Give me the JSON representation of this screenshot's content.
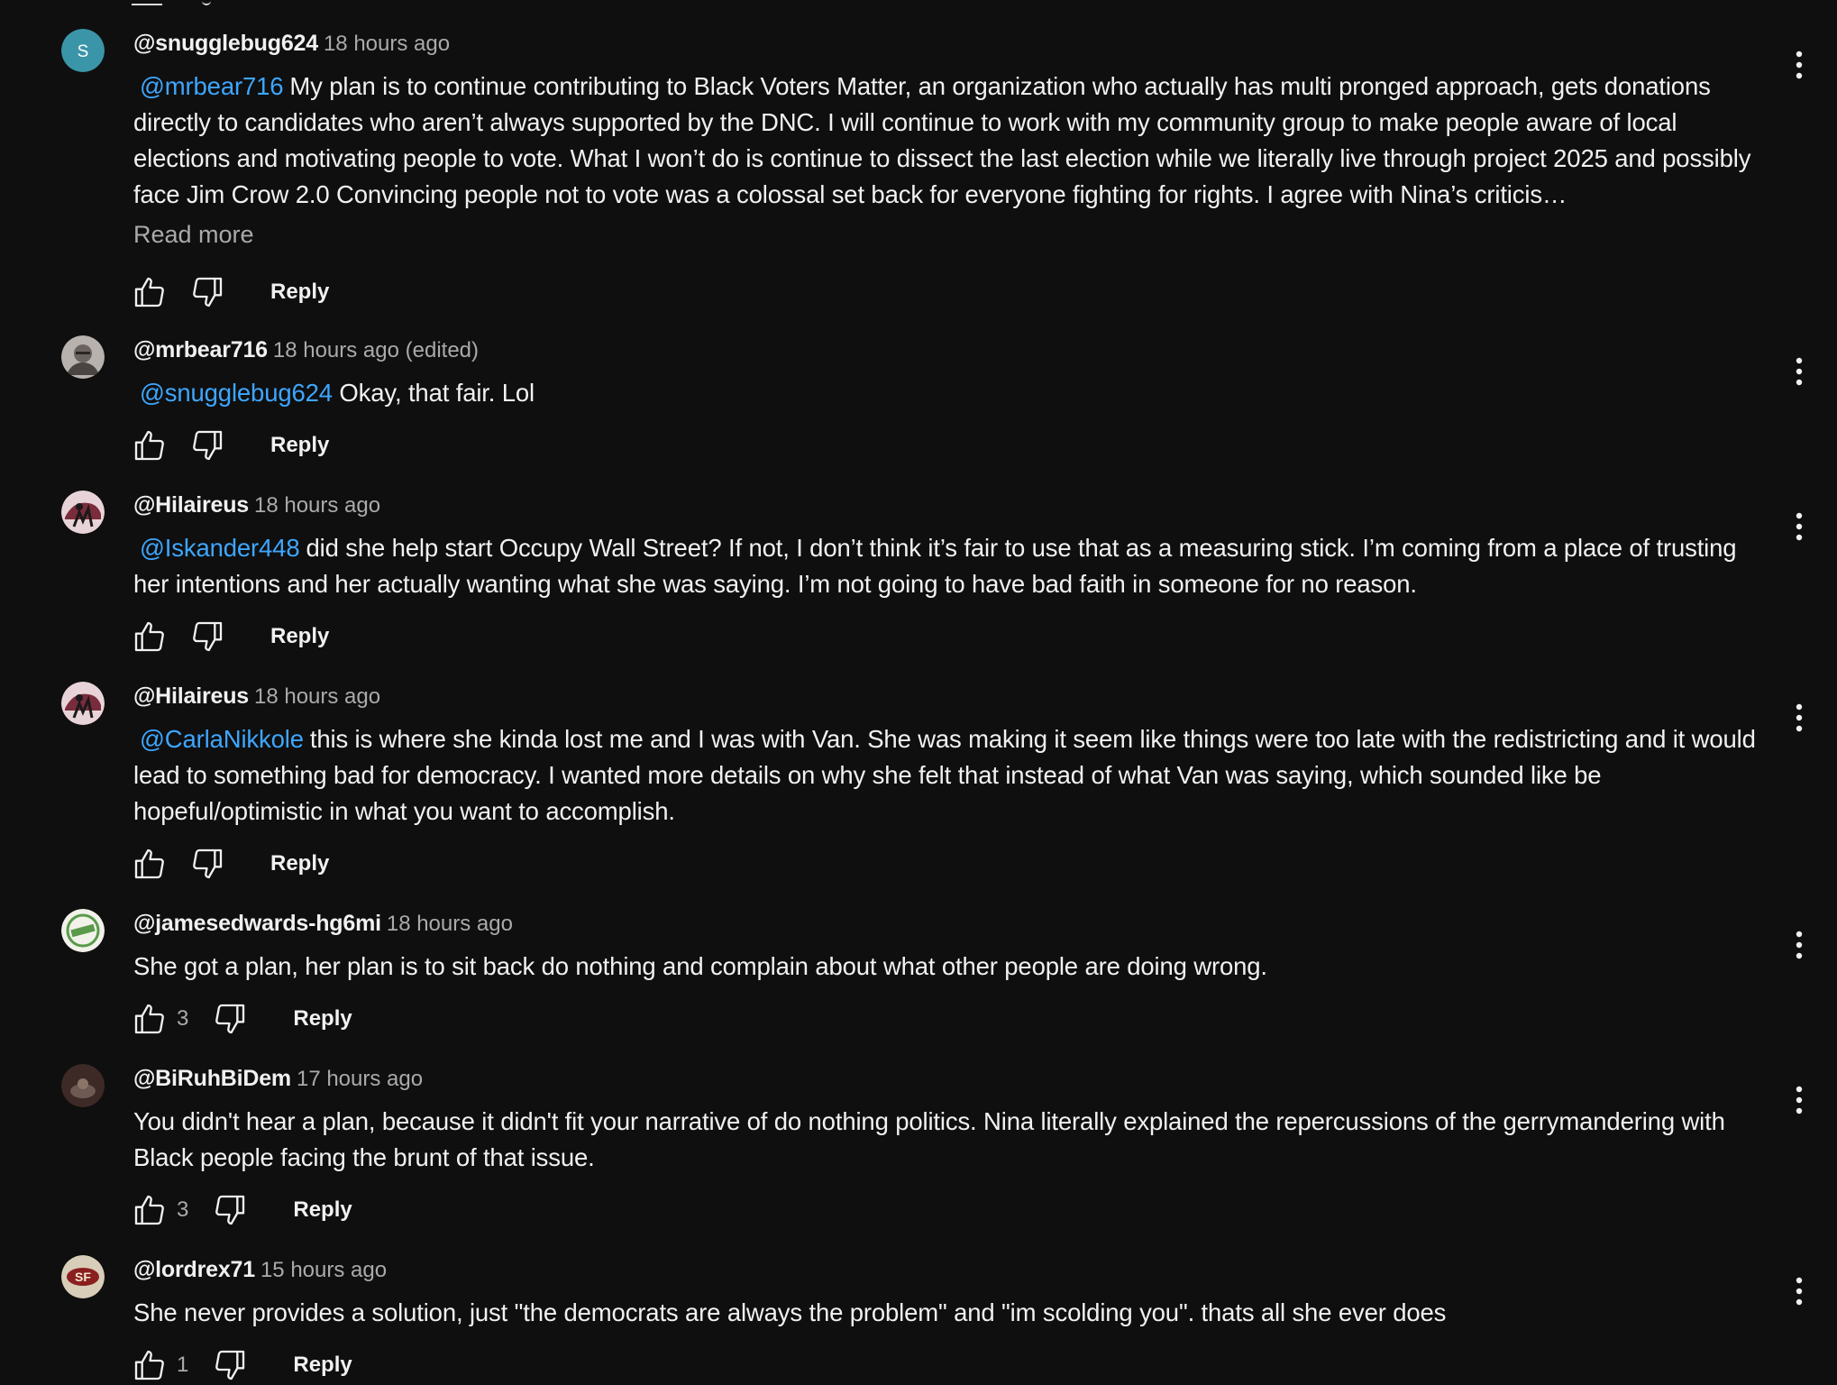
{
  "comments": [
    {
      "author": "@snugglebug624",
      "time": "18 hours ago",
      "mention": "@mrbear716",
      "text": "My plan is to continue contributing to Black Voters Matter, an organization who actually has multi pronged approach, gets donations directly to candidates who aren’t always supported by the DNC. I will continue to work with my community group to make people aware of local elections and motivating people to vote. What I won’t do is continue to dissect the last election while we literally live through project 2025 and possibly face Jim Crow 2.0 Convincing people not to vote was a colossal set back for everyone fighting for rights. I agree with Nina’s criticis…",
      "read_more": "Read more",
      "likes": "",
      "reply": "Reply",
      "avatar": {
        "type": "letter",
        "letter": "S",
        "color": "#3b95a9"
      }
    },
    {
      "author": "@mrbear716",
      "time": "18 hours ago (edited)",
      "mention": "@snugglebug624",
      "text": "Okay, that fair. Lol",
      "likes": "",
      "reply": "Reply",
      "avatar": {
        "type": "photo",
        "color": "#6b6360"
      }
    },
    {
      "author": "@Hilaireus",
      "time": "18 hours ago",
      "mention": "@Iskander448",
      "text": "did she help start Occupy Wall Street? If not, I don’t think it’s fair to use that as a measuring stick. I’m coming from a place of trusting her intentions and her actually wanting what she was saying. I’m not going to have bad faith in someone for no reason.",
      "likes": "",
      "reply": "Reply",
      "avatar": {
        "type": "photo",
        "color": "#7a2c3c"
      }
    },
    {
      "author": "@Hilaireus",
      "time": "18 hours ago",
      "mention": "@CarlaNikkole",
      "text": "this is where she kinda lost me and I was with Van. She was making it seem like things were too late with the redistricting and it would lead to something bad for democracy. I wanted more details on why she felt that instead of what Van was saying, which sounded like be hopeful/optimistic in what you want to accomplish.",
      "likes": "",
      "reply": "Reply",
      "avatar": {
        "type": "photo",
        "color": "#7a2c3c"
      }
    },
    {
      "author": "@jamesedwards-hg6mi",
      "time": "18 hours ago",
      "mention": "",
      "text": "She got a plan, her plan is to sit back do nothing and complain about what other people are doing wrong.",
      "likes": "3",
      "reply": "Reply",
      "avatar": {
        "type": "photo",
        "color": "#5a9a4a"
      }
    },
    {
      "author": "@BiRuhBiDem",
      "time": "17 hours ago",
      "mention": "",
      "text": "You didn't hear a plan, because it didn't fit your narrative of do nothing politics. Nina literally explained the repercussions of the gerrymandering with Black people facing the brunt of that issue.",
      "likes": "3",
      "reply": "Reply",
      "avatar": {
        "type": "photo",
        "color": "#3d2a26"
      }
    },
    {
      "author": "@lordrex71",
      "time": "15 hours ago",
      "mention": "",
      "text": "She never provides a solution, just \"the democrats are always the problem\" and \"im scolding you\". thats all she ever does",
      "likes": "1",
      "reply": "Reply",
      "avatar": {
        "type": "photo",
        "color": "#8a1f1f"
      }
    }
  ],
  "icons": {
    "like": "thumbs-up-icon",
    "dislike": "thumbs-down-icon",
    "more": "more-vert-icon"
  }
}
